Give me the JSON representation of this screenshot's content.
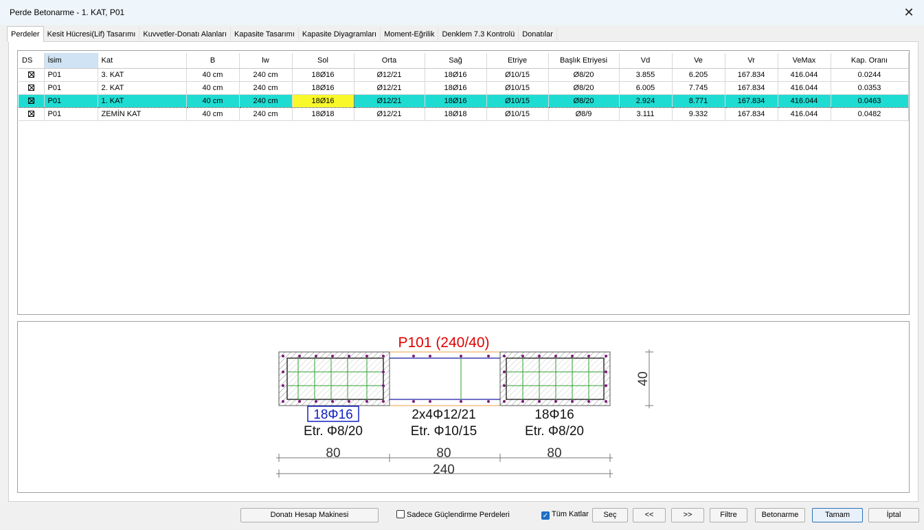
{
  "window": {
    "title": "Perde Betonarme - 1. KAT, P01",
    "close_glyph": "✕"
  },
  "tabs": [
    "Perdeler",
    "Kesit Hücresi(Lif) Tasarımı",
    "Kuvvetler-Donatı Alanları",
    "Kapasite Tasarımı",
    "Kapasite Diyagramları",
    "Moment-Eğrilik",
    "Denklem 7.3 Kontrolü",
    "Donatılar"
  ],
  "table": {
    "columns": [
      "DS",
      "İsim",
      "Kat",
      "B",
      "lw",
      "Sol",
      "Orta",
      "Sağ",
      "Etriye",
      "Başlık Etriyesi",
      "Vd",
      "Ve",
      "Vr",
      "VeMax",
      "Kap. Oranı"
    ],
    "rows": [
      [
        "P01",
        "3. KAT",
        "40 cm",
        "240 cm",
        "18Ø16",
        "Ø12/21",
        "18Ø16",
        "Ø10/15",
        "Ø8/20",
        "3.855",
        "6.205",
        "167.834",
        "416.044",
        "0.0244"
      ],
      [
        "P01",
        "2. KAT",
        "40 cm",
        "240 cm",
        "18Ø16",
        "Ø12/21",
        "18Ø16",
        "Ø10/15",
        "Ø8/20",
        "6.005",
        "7.745",
        "167.834",
        "416.044",
        "0.0353"
      ],
      [
        "P01",
        "1. KAT",
        "40 cm",
        "240 cm",
        "18Ø16",
        "Ø12/21",
        "18Ø16",
        "Ø10/15",
        "Ø8/20",
        "2.924",
        "8.771",
        "167.834",
        "416.044",
        "0.0463"
      ],
      [
        "P01",
        "ZEMİN KAT",
        "40 cm",
        "240 cm",
        "18Ø18",
        "Ø12/21",
        "18Ø18",
        "Ø10/15",
        "Ø8/9",
        "3.111",
        "9.332",
        "167.834",
        "416.044",
        "0.0482"
      ]
    ],
    "selected_row": 2
  },
  "drawing": {
    "title": "P101 (240/40)",
    "left_bar": "18Φ16",
    "left_stirrup": "Etr. Φ8/20",
    "mid_bar": "2x4Φ12/21",
    "mid_stirrup": "Etr. Φ10/15",
    "right_bar": "18Φ16",
    "right_stirrup": "Etr. Φ8/20",
    "dim_left": "80",
    "dim_mid": "80",
    "dim_right": "80",
    "dim_total": "240",
    "dim_height": "40",
    "title_color": "#e00000",
    "highlight_color": "#1020c0"
  },
  "bottom": {
    "calc_button": "Donatı Hesap Makinesi",
    "only_strengthen": "Sadece Güçlendirme Perdeleri",
    "all_floors": "Tüm Katlar",
    "select": "Seç",
    "prev": "<<",
    "next": ">>",
    "filter": "Filtre",
    "concrete": "Betonarme",
    "ok": "Tamam",
    "cancel": "İptal"
  },
  "colors": {
    "selected_row": "#1fdcd2",
    "highlight_cell": "#f8f82a",
    "header_highlight": "#cfe3f4"
  }
}
